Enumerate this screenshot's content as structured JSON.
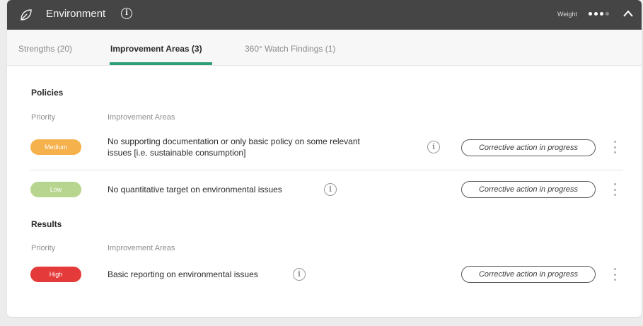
{
  "header": {
    "title": "Environment",
    "weight_label": "Weight",
    "weight_level": "3 of 4",
    "icon_left": "leaf-icon",
    "icon_info": "info-icon",
    "icon_collapse": "chevron-up-icon"
  },
  "tabs": [
    {
      "label": "Strengths (20)",
      "active": false
    },
    {
      "label": "Improvement Areas (3)",
      "active": true
    },
    {
      "label": "360° Watch Findings (1)",
      "active": false
    }
  ],
  "sections": [
    {
      "title": "Policies",
      "columns": {
        "priority": "Priority",
        "areas": "Improvement Areas"
      },
      "rows": [
        {
          "priority": "Medium",
          "text_line1": "No supporting documentation or only basic policy on some relevant",
          "text_line2": "issues [i.e. sustainable consumption]",
          "action": "Corrective action in progress"
        },
        {
          "priority": "Low",
          "text": "No quantitative target on environmental issues",
          "action": "Corrective action in progress"
        }
      ]
    },
    {
      "title": "Results",
      "columns": {
        "priority": "Priority",
        "areas": "Improvement Areas"
      },
      "rows": [
        {
          "priority": "High",
          "text": "Basic reporting on environmental issues",
          "action": "Corrective action in progress"
        }
      ]
    }
  ],
  "colors": {
    "header_bg": "#454545",
    "tab_accent": "#2e9e78",
    "priority_medium": "#f5b14c",
    "priority_low": "#b7d58e",
    "priority_high": "#e53a3a"
  }
}
